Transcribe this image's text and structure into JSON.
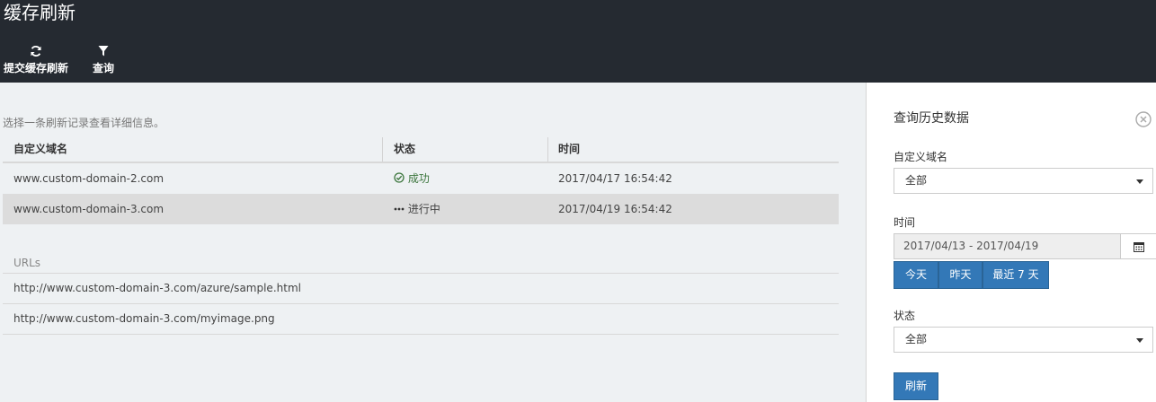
{
  "header": {
    "title": "缓存刷新",
    "commands": [
      {
        "label": "提交缓存刷新",
        "icon": "refresh-icon"
      },
      {
        "label": "查询",
        "icon": "filter-icon"
      }
    ]
  },
  "main": {
    "hint": "选择一条刷新记录查看详细信息。",
    "columns": [
      "自定义域名",
      "状态",
      "时间"
    ],
    "rows": [
      {
        "domain": "www.custom-domain-2.com",
        "status": "成功",
        "time": "2017/04/17 16:54:42"
      },
      {
        "domain": "www.custom-domain-3.com",
        "status": "进行中",
        "time": "2017/04/19 16:54:42"
      }
    ],
    "urls_header": "URLs",
    "urls": [
      "http://www.custom-domain-3.com/azure/sample.html",
      "http://www.custom-domain-3.com/myimage.png"
    ]
  },
  "panel": {
    "title": "查询历史数据",
    "domain_label": "自定义域名",
    "domain_value": "全部",
    "time_label": "时间",
    "date_range": "2017/04/13 - 2017/04/19",
    "quick_ranges": [
      "今天",
      "昨天",
      "最近 7 天"
    ],
    "status_label": "状态",
    "status_value": "全部",
    "refresh_label": "刷新"
  },
  "colors": {
    "topbar": "#252a31",
    "accent": "#3378b7",
    "success": "#3c763d"
  }
}
